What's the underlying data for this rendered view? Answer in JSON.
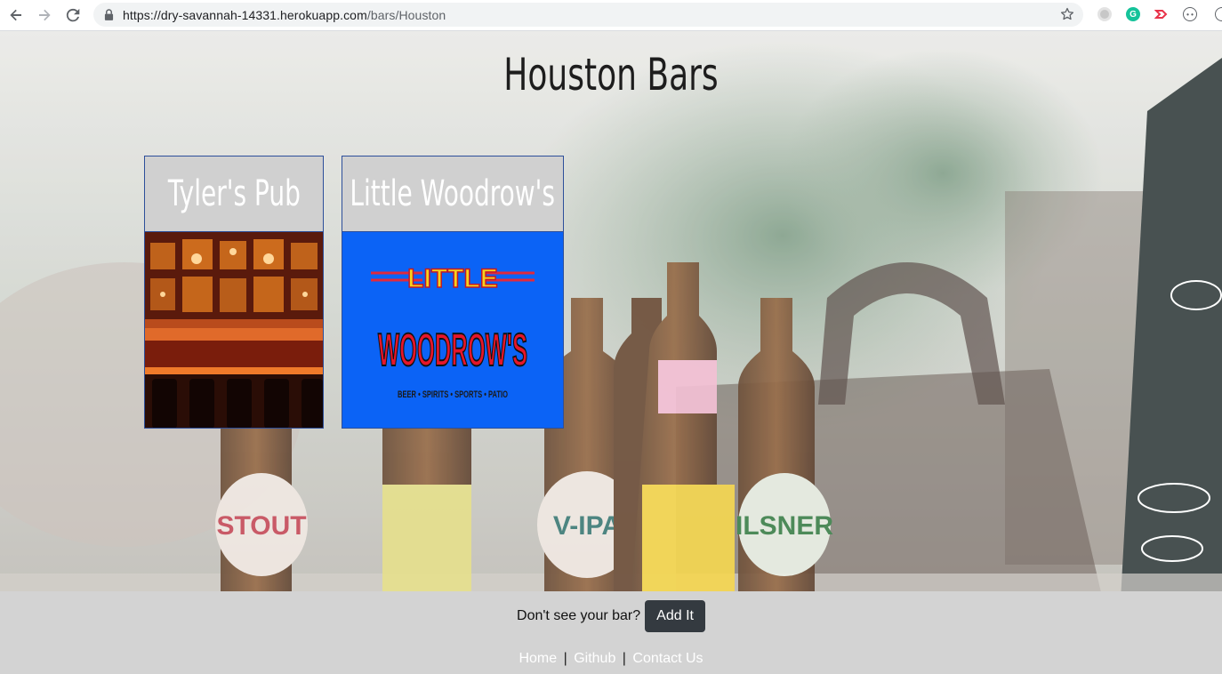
{
  "browser": {
    "url_host": "https://dry-savannah-14331.herokuapp.com",
    "url_path": "/bars/Houston"
  },
  "page": {
    "title": "Houston Bars"
  },
  "bars": [
    {
      "name": "Tyler's Pub"
    },
    {
      "name": "Little Woodrow's",
      "logo_text_top": "LITTLE",
      "logo_text_main": "WOODROW'S",
      "logo_tagline": "BEER • SPIRITS • SPORTS • PATIO"
    }
  ],
  "footer": {
    "prompt": "Don't see your bar?",
    "add_button": "Add It",
    "links": [
      "Home",
      "Github",
      "Contact Us"
    ],
    "separator": "|"
  },
  "colors": {
    "accent_blue": "#0b63f6",
    "button_dark": "#343a40",
    "footer_bg": "#d3d3d3",
    "card_border": "#2d4f9a"
  }
}
